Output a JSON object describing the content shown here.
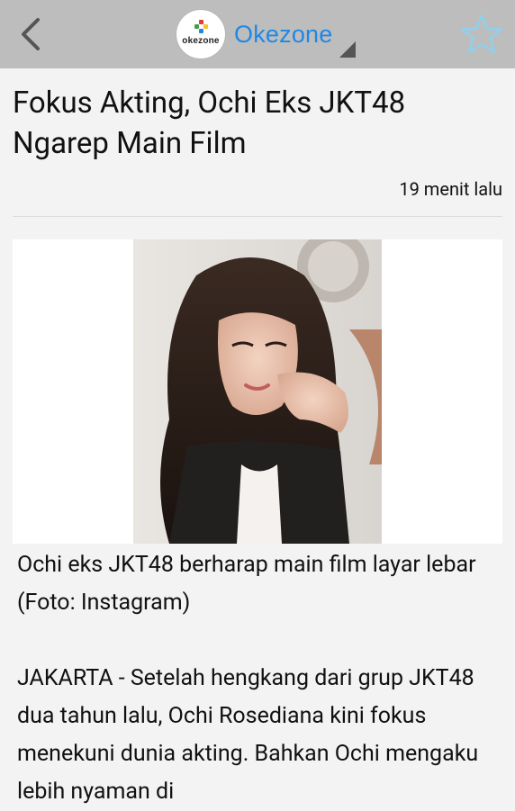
{
  "app": {
    "site_name": "Okezone",
    "logo_text": "okezone",
    "accent_color": "#1e88e5",
    "toolbar_color": "#bdbdbd",
    "icons": {
      "back": "chevron-left-icon",
      "favorite": "star-outline-icon",
      "dropdown": "dropdown-corner-icon"
    }
  },
  "article": {
    "title": "Fokus Akting, Ochi Eks JKT48 Ngarep Main Film",
    "time": "19 menit lalu",
    "photo_caption": "Ochi eks JKT48 berharap main film layar lebar (Foto: Instagram)",
    "body": "JAKARTA - Setelah hengkang dari grup JKT48 dua tahun lalu, Ochi Rosediana kini fokus menekuni dunia akting. Bahkan Ochi mengaku lebih nyaman di"
  }
}
